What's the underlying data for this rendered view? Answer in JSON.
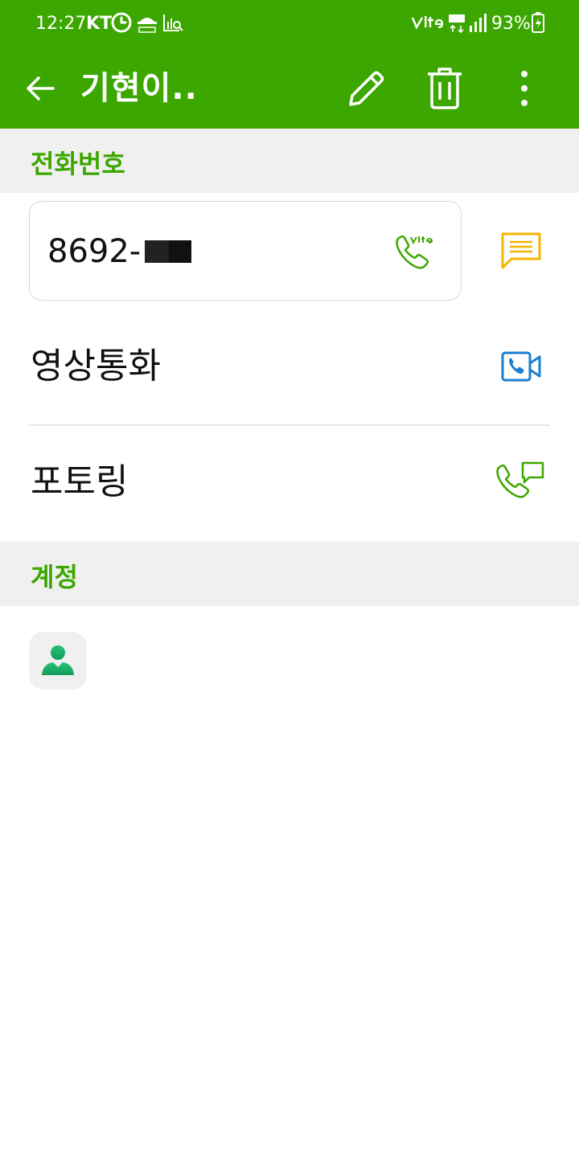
{
  "status_bar": {
    "time": "12:27",
    "carrier": "KT",
    "left_icons": [
      "clock-app-icon",
      "raon-app-icon",
      "data-usage-icon"
    ],
    "right_icons": [
      "volte-icon",
      "lte-icon",
      "signal-icon",
      "battery-charging-icon"
    ],
    "battery_percent": "93%"
  },
  "app_bar": {
    "title": "기현이..",
    "back_icon": "back-arrow-icon",
    "actions": [
      "edit-pencil-icon",
      "delete-trash-icon",
      "more-vert-icon"
    ]
  },
  "sections": {
    "phone": {
      "header": "전화번호",
      "number_visible": "8692-",
      "call_icon": "volte-call-icon",
      "message_icon": "message-icon"
    },
    "video_call": {
      "label": "영상통화",
      "icon": "video-call-icon"
    },
    "tone_ring": {
      "label": "포토링",
      "icon": "call-message-icon"
    },
    "account": {
      "header": "계정",
      "icon": "contact-person-icon"
    }
  },
  "colors": {
    "primary_green": "#3ca700",
    "section_bg": "#f0f0f0",
    "message_yellow": "#f5b400",
    "video_blue": "#1a7fd1",
    "account_green": "#1fb06a"
  }
}
